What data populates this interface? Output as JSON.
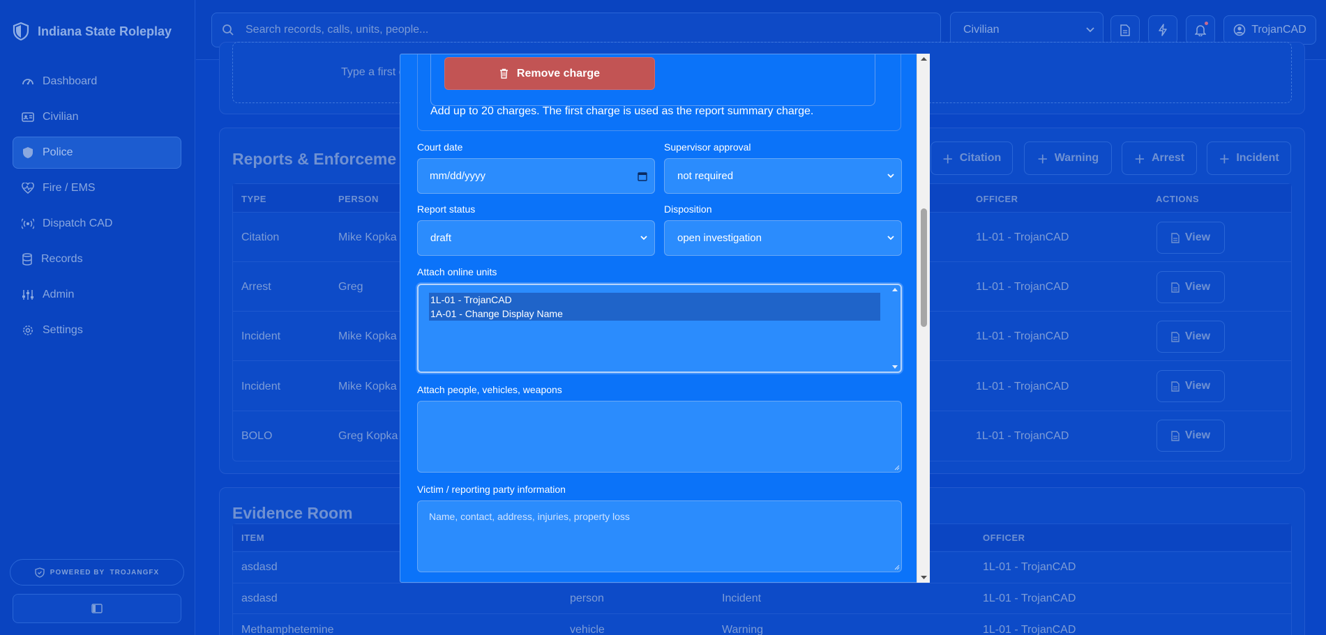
{
  "brand": {
    "name": "Indiana State Roleplay"
  },
  "sidebar": {
    "items": [
      {
        "label": "Dashboard",
        "icon": "gauge-icon"
      },
      {
        "label": "Civilian",
        "icon": "id-card-icon"
      },
      {
        "label": "Police",
        "icon": "shield-icon",
        "active": true
      },
      {
        "label": "Fire / EMS",
        "icon": "heart-pulse-icon"
      },
      {
        "label": "Dispatch CAD",
        "icon": "broadcast-icon"
      },
      {
        "label": "Records",
        "icon": "database-icon"
      },
      {
        "label": "Admin",
        "icon": "sliders-icon"
      },
      {
        "label": "Settings",
        "icon": "gear-icon"
      }
    ],
    "powered_by": "POWERED BY  TROJANGFX"
  },
  "header": {
    "search_placeholder": "Search records, calls, units, people...",
    "role_select": "Civilian",
    "user": "TrojanCAD"
  },
  "background": {
    "drop_hint": "Type a first c",
    "reports_title": "Reports & Enforceme",
    "actions": [
      "Citation",
      "Warning",
      "Arrest",
      "Incident"
    ],
    "reports_columns": {
      "type": "TYPE",
      "person": "PERSON",
      "officer": "OFFICER",
      "actions": "ACTIONS"
    },
    "reports_rows": [
      {
        "type": "Citation",
        "person": "Mike Kopka",
        "officer": "1L-01 - TrojanCAD",
        "action": "View"
      },
      {
        "type": "Arrest",
        "person": "Greg",
        "officer": "1L-01 - TrojanCAD",
        "action": "View"
      },
      {
        "type": "Incident",
        "person": "Mike Kopka",
        "officer": "1L-01 - TrojanCAD",
        "action": "View"
      },
      {
        "type": "Incident",
        "person": "Mike Kopka",
        "officer": "1L-01 - TrojanCAD",
        "action": "View"
      },
      {
        "type": "BOLO",
        "person": "Greg Kopka",
        "officer": "1L-01 - TrojanCAD",
        "action": "View"
      }
    ],
    "evidence_title": "Evidence Room",
    "evidence_columns": {
      "item": "ITEM",
      "officer": "OFFICER"
    },
    "evidence_rows": [
      {
        "item": "asdasd",
        "kind": "",
        "report": "",
        "officer": "1L-01 - TrojanCAD"
      },
      {
        "item": "asdasd",
        "kind": "person",
        "report": "Incident",
        "officer": "1L-01 - TrojanCAD"
      },
      {
        "item": "Methamphetemine",
        "kind": "vehicle",
        "report": "Warning",
        "officer": "1L-01 - TrojanCAD"
      }
    ]
  },
  "modal": {
    "remove_charge": "Remove charge",
    "charges_hint": "Add up to 20 charges. The first charge is used as the report summary charge.",
    "court_date_label": "Court date",
    "court_date_value": "mm/dd/yyyy",
    "supervisor_label": "Supervisor approval",
    "supervisor_value": "not required",
    "status_label": "Report status",
    "status_value": "draft",
    "disposition_label": "Disposition",
    "disposition_value": "open investigation",
    "units_label": "Attach online units",
    "units": [
      "1L-01 - TrojanCAD",
      "1A-01 - Change Display Name"
    ],
    "attach_label": "Attach people, vehicles, weapons",
    "victim_label": "Victim / reporting party information",
    "victim_placeholder": "Name, contact, address, injuries, property loss"
  }
}
